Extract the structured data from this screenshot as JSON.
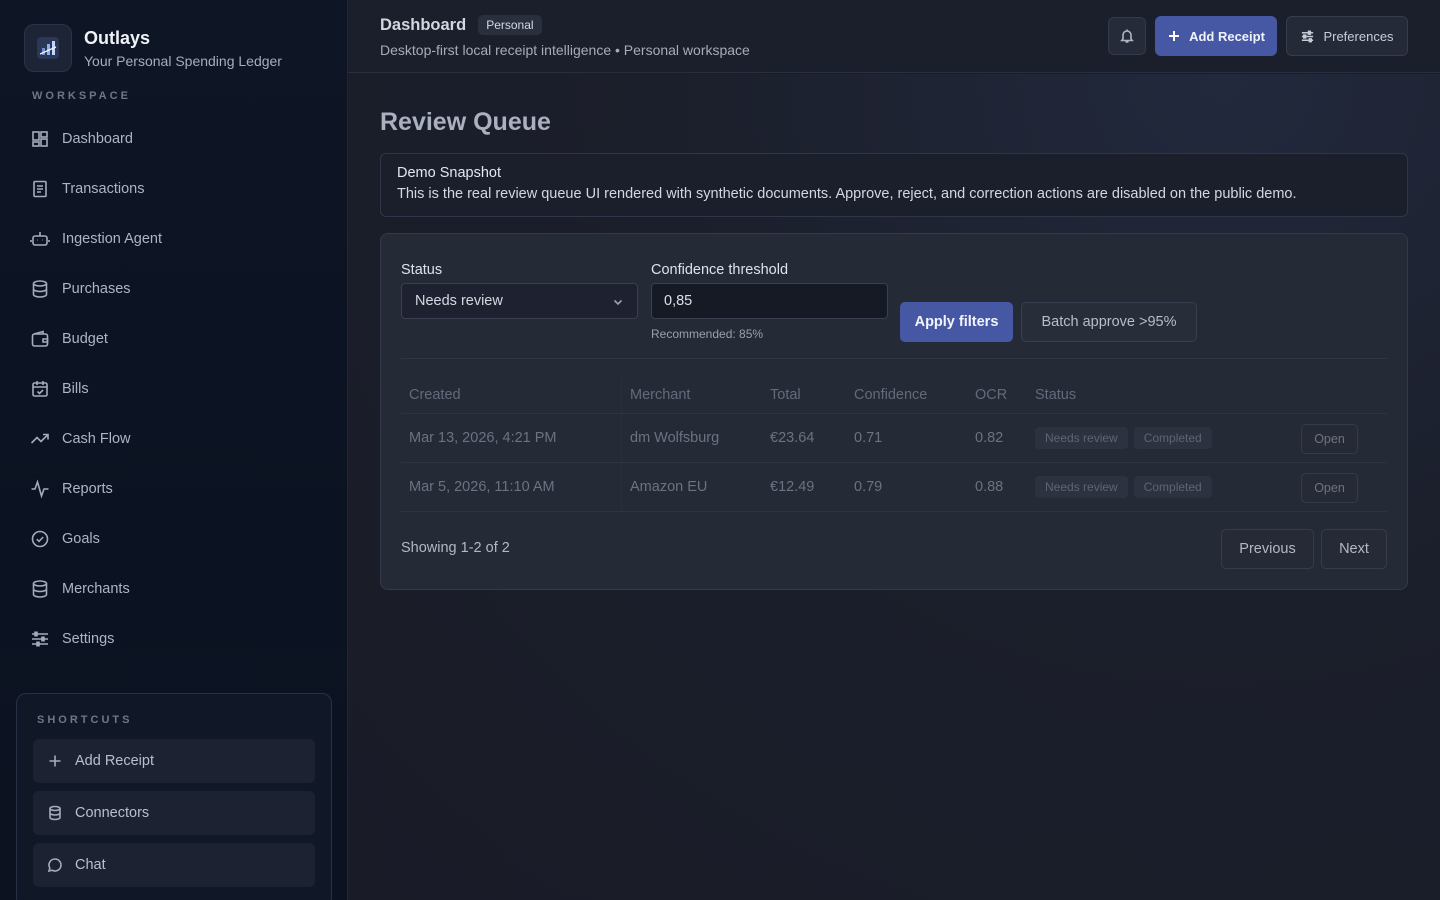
{
  "brand": {
    "name": "Outlays",
    "tagline": "Your Personal Spending Ledger"
  },
  "sidebar": {
    "section_label": "WORKSPACE",
    "items": [
      {
        "label": "Dashboard",
        "icon": "grid-icon"
      },
      {
        "label": "Transactions",
        "icon": "document-icon"
      },
      {
        "label": "Ingestion Agent",
        "icon": "robot-icon"
      },
      {
        "label": "Purchases",
        "icon": "database-icon"
      },
      {
        "label": "Budget",
        "icon": "wallet-icon"
      },
      {
        "label": "Bills",
        "icon": "calendar-check-icon"
      },
      {
        "label": "Cash Flow",
        "icon": "trending-up-icon"
      },
      {
        "label": "Reports",
        "icon": "activity-icon"
      },
      {
        "label": "Goals",
        "icon": "check-circle-icon"
      },
      {
        "label": "Merchants",
        "icon": "database-icon"
      },
      {
        "label": "Settings",
        "icon": "sliders-icon"
      }
    ],
    "shortcuts": {
      "title": "SHORTCUTS",
      "items": [
        {
          "label": "Add Receipt",
          "icon": "plus-icon"
        },
        {
          "label": "Connectors",
          "icon": "database-icon"
        },
        {
          "label": "Chat",
          "icon": "chat-bubble-icon"
        }
      ]
    }
  },
  "header": {
    "title": "Dashboard",
    "badge": "Personal",
    "subtitle": "Desktop-first local receipt intelligence • Personal workspace",
    "add_receipt_label": "Add Receipt",
    "preferences_label": "Preferences"
  },
  "main": {
    "title": "Review Queue",
    "notice": {
      "title": "Demo Snapshot",
      "body": "This is the real review queue UI rendered with synthetic documents. Approve, reject, and correction actions are disabled on the public demo."
    },
    "filters": {
      "status_label": "Status",
      "status_value": "Needs review",
      "threshold_label": "Confidence threshold",
      "threshold_value": "0,85",
      "threshold_hint": "Recommended: 85%",
      "apply_label": "Apply filters",
      "batch_label": "Batch approve >95%"
    },
    "table": {
      "headers": [
        "Created",
        "Merchant",
        "Total",
        "Confidence",
        "OCR",
        "Status"
      ],
      "rows": [
        {
          "created": "Mar 13, 2026, 4:21 PM",
          "merchant": "dm Wolfsburg",
          "total": "€23.64",
          "confidence": "0.71",
          "ocr": "0.82",
          "status1": "Needs review",
          "status2": "Completed",
          "action": "Open"
        },
        {
          "created": "Mar 5, 2026, 11:10 AM",
          "merchant": "Amazon EU",
          "total": "€12.49",
          "confidence": "0.79",
          "ocr": "0.88",
          "status1": "Needs review",
          "status2": "Completed",
          "action": "Open"
        }
      ]
    },
    "pagination": {
      "showing": "Showing 1-2 of 2",
      "previous": "Previous",
      "next": "Next"
    }
  },
  "colors": {
    "accent": "#4658a3",
    "sidebar_bg": "#0e1626",
    "main_bg": "#1a1d29"
  }
}
